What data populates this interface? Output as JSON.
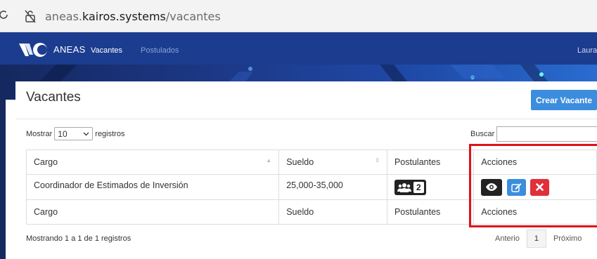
{
  "browser": {
    "url_prefix": "aneas.",
    "url_domain": "kairos.systems",
    "url_path": "/vacantes"
  },
  "navbar": {
    "brand": "ANEAS",
    "links": [
      {
        "label": "Vacantes",
        "active": true
      },
      {
        "label": "Postulados",
        "active": false
      }
    ],
    "user": "Laura",
    "color": "#1b3c8f"
  },
  "panel": {
    "title": "Vacantes",
    "create_button": "Crear Vacante"
  },
  "table_controls": {
    "show_prefix": "Mostrar",
    "page_size": "10",
    "show_suffix": "registros",
    "search_label": "Buscar",
    "search_value": ""
  },
  "table": {
    "columns": [
      "Cargo",
      "Sueldo",
      "Postulantes",
      "Acciones"
    ],
    "rows": [
      {
        "cargo": "Coordinador de Estimados de Inversión",
        "sueldo": "25,000-35,000",
        "postulantes": "2"
      }
    ]
  },
  "footer": {
    "info": "Mostrando 1 a 1 de 1 registros",
    "prev": "Anterio",
    "current_page": "1",
    "next": "Próximo"
  },
  "icons": {
    "view": "eye-icon",
    "edit": "edit-icon",
    "delete": "delete-icon",
    "applicants": "users-icon"
  },
  "colors": {
    "primary": "#3c8dde",
    "danger": "#e0303a",
    "highlight": "#e0101a"
  }
}
